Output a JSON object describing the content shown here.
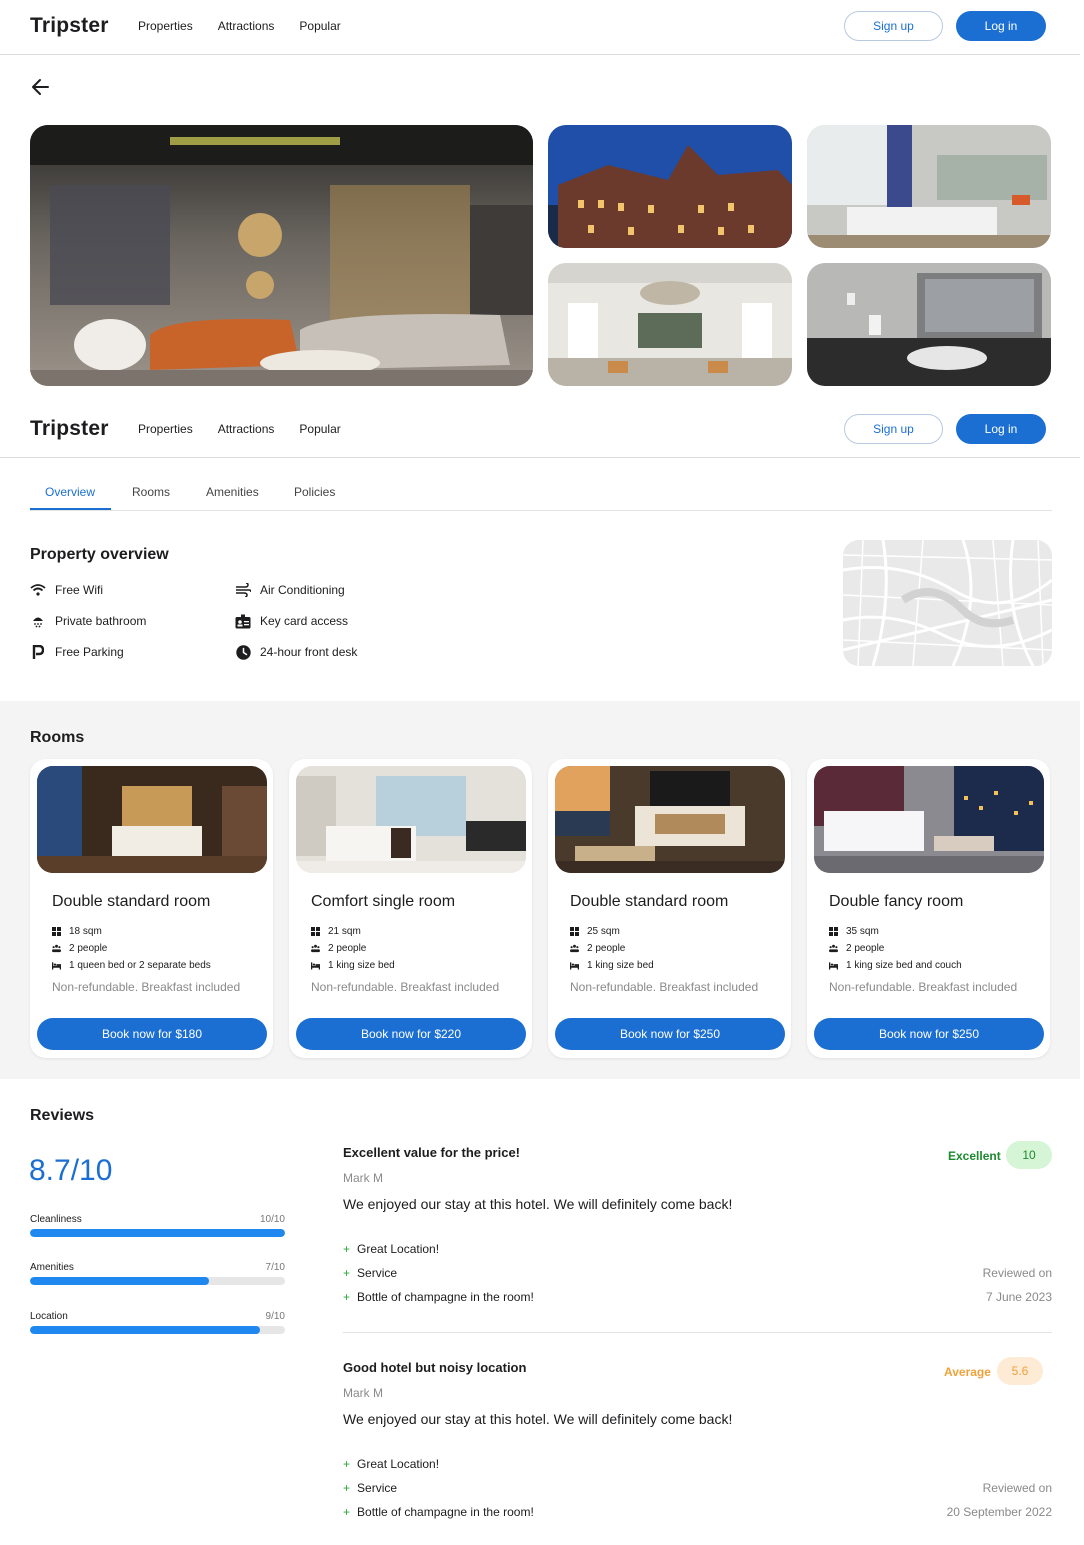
{
  "header": {
    "logo": "Tripster",
    "nav": [
      "Properties",
      "Attractions",
      "Popular"
    ],
    "signup_label": "Sign up",
    "login_label": "Log in"
  },
  "tabs": [
    "Overview",
    "Rooms",
    "Amenities",
    "Policies"
  ],
  "overview": {
    "title": "Property overview",
    "amenities": [
      {
        "label": "Free Wifi",
        "icon": "wifi-icon"
      },
      {
        "label": "Private bathroom",
        "icon": "shower-icon"
      },
      {
        "label": "Free Parking",
        "icon": "parking-icon"
      },
      {
        "label": "Air Conditioning",
        "icon": "air-conditioning-icon"
      },
      {
        "label": "Key card access",
        "icon": "key-card-icon"
      },
      {
        "label": "24-hour front desk",
        "icon": "clock-icon"
      }
    ]
  },
  "rooms": {
    "title": "Rooms",
    "items": [
      {
        "name": "Double standard room",
        "size": "18 sqm",
        "people": "2 people",
        "beds": "1 queen bed or 2 separate beds",
        "policy": "Non-refundable. Breakfast included",
        "book_label": "Book now for $180"
      },
      {
        "name": "Comfort single room",
        "size": "21 sqm",
        "people": "2 people",
        "beds": "1 king size bed",
        "policy": "Non-refundable. Breakfast included",
        "book_label": "Book now for $220"
      },
      {
        "name": "Double standard room",
        "size": "25 sqm",
        "people": "2 people",
        "beds": "1 king size bed",
        "policy": "Non-refundable. Breakfast included",
        "book_label": "Book now for $250"
      },
      {
        "name": "Double fancy room",
        "size": "35 sqm",
        "people": "2 people",
        "beds": "1 king size bed and couch",
        "policy": "Non-refundable. Breakfast included",
        "book_label": "Book now for $250"
      }
    ]
  },
  "reviews": {
    "title": "Reviews",
    "score": "8.7/10",
    "categories": [
      {
        "label": "Cleanliness",
        "value": "10/10",
        "fraction": 1.0
      },
      {
        "label": "Amenities",
        "value": "7/10",
        "fraction": 0.7
      },
      {
        "label": "Location",
        "value": "9/10",
        "fraction": 0.9
      }
    ],
    "items": [
      {
        "headline": "Excellent value for the price!",
        "author": "Mark M",
        "text": "We enjoyed our stay at this hotel. We will definitely come back!",
        "pros": [
          "Great Location!",
          "Service",
          "Bottle of champagne in the room!"
        ],
        "rating_label": "Excellent",
        "rating": "10",
        "rating_color": "#1c8a2e",
        "badge_bg": "#d6f5d6",
        "reviewed_label": "Reviewed on",
        "date": "7 June 2023"
      },
      {
        "headline": "Good hotel but noisy location",
        "author": "Mark M",
        "text": "We enjoyed our stay at this hotel. We will definitely come back!",
        "pros": [
          "Great Location!",
          "Service",
          "Bottle of champagne in the room!"
        ],
        "rating_label": "Average",
        "rating": "5.6",
        "rating_color": "#f0a23a",
        "badge_bg": "#fdebd6",
        "reviewed_label": "Reviewed on",
        "date": "20 September 2022"
      }
    ]
  },
  "colors": {
    "accent": "#1b6fd2",
    "bar": "#1e88f0",
    "positive": "#2aa53b"
  }
}
